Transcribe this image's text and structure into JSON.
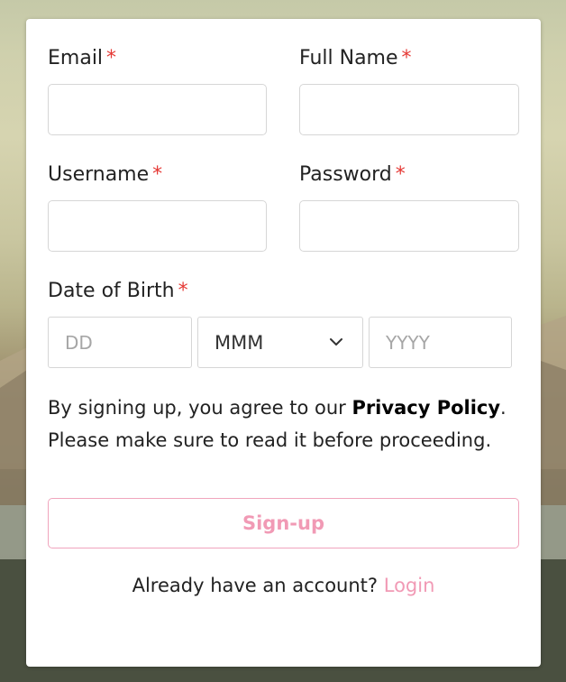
{
  "form": {
    "email": {
      "label": "Email",
      "required_mark": "*",
      "value": "",
      "placeholder": ""
    },
    "full_name": {
      "label": "Full Name",
      "required_mark": "*",
      "value": "",
      "placeholder": ""
    },
    "username": {
      "label": "Username",
      "required_mark": "*",
      "value": "",
      "placeholder": ""
    },
    "password": {
      "label": "Password",
      "required_mark": "*",
      "value": "",
      "placeholder": ""
    },
    "dob": {
      "label": "Date of Birth",
      "required_mark": "*",
      "day_placeholder": "DD",
      "month_selected": "MMM",
      "year_placeholder": "YYYY"
    }
  },
  "consent": {
    "prefix": "By signing up, you agree to our ",
    "policy_link": "Privacy Policy",
    "suffix": ".",
    "line2": "Please make sure to read it before proceeding."
  },
  "signup_button": {
    "label": "Sign-up"
  },
  "login": {
    "prompt": "Already have an account? ",
    "link": "Login"
  },
  "colors": {
    "required": "#e53935",
    "accent_pink": "#f19ab5",
    "border": "#d6d6d6"
  },
  "icons": {
    "month_dropdown": "chevron-down-icon"
  }
}
